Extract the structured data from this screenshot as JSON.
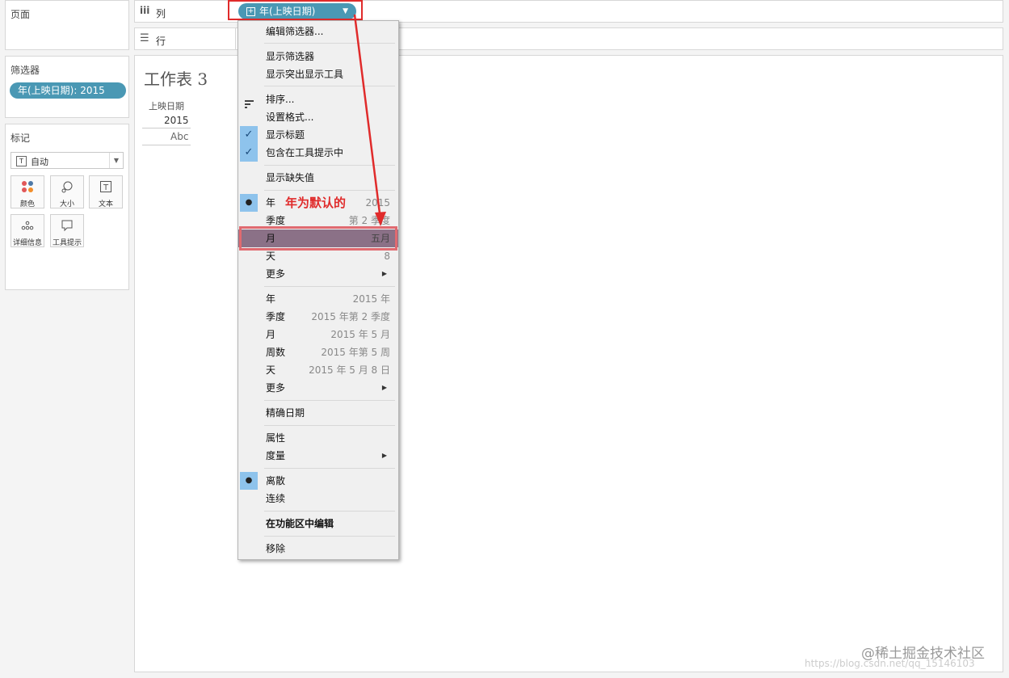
{
  "pages_panel": {
    "title": "页面"
  },
  "filters_panel": {
    "title": "筛选器",
    "pill": "年(上映日期): 2015"
  },
  "marks_panel": {
    "title": "标记",
    "type_select": "自动",
    "buttons": [
      {
        "label": "颜色",
        "icon": "color-icon"
      },
      {
        "label": "大小",
        "icon": "size-icon"
      },
      {
        "label": "文本",
        "icon": "text-icon"
      },
      {
        "label": "详细信息",
        "icon": "detail-icon"
      },
      {
        "label": "工具提示",
        "icon": "tooltip-icon"
      }
    ]
  },
  "columns_shelf": {
    "label": "列",
    "pill": "年(上映日期)"
  },
  "rows_shelf": {
    "label": "行"
  },
  "sheet": {
    "title": "工作表 3",
    "header": "上映日期",
    "year": "2015",
    "value": "Abc"
  },
  "menu": {
    "edit_filter": "编辑筛选器...",
    "show_filter": "显示筛选器",
    "show_highlighter": "显示突出显示工具",
    "sort": "排序...",
    "format": "设置格式...",
    "show_header": "显示标题",
    "include_tooltip": "包含在工具提示中",
    "show_missing": "显示缺失值",
    "date_parts": [
      {
        "label": "年",
        "value": "2015",
        "selected": true
      },
      {
        "label": "季度",
        "value": "第 2 季度"
      },
      {
        "label": "月",
        "value": "五月",
        "highlighted": true
      },
      {
        "label": "天",
        "value": "8"
      },
      {
        "label": "更多",
        "submenu": true
      }
    ],
    "date_values": [
      {
        "label": "年",
        "value": "2015 年"
      },
      {
        "label": "季度",
        "value": "2015 年第 2 季度"
      },
      {
        "label": "月",
        "value": "2015 年 5 月"
      },
      {
        "label": "周数",
        "value": "2015 年第 5 周"
      },
      {
        "label": "天",
        "value": "2015 年 5 月 8 日"
      },
      {
        "label": "更多",
        "submenu": true
      }
    ],
    "exact_date": "精确日期",
    "attribute": "属性",
    "measure": "度量",
    "discrete": "离散",
    "continuous": "连续",
    "edit_in_shelf": "在功能区中编辑",
    "remove": "移除"
  },
  "annotation": {
    "text": "年为默认的"
  },
  "watermark": {
    "text": "@稀土掘金技术社区",
    "url": "https://blog.csdn.net/qq_15146103"
  },
  "colors": {
    "pill": "#4a98b4",
    "annotation": "#e02b2b",
    "highlight": "#8b7187"
  }
}
